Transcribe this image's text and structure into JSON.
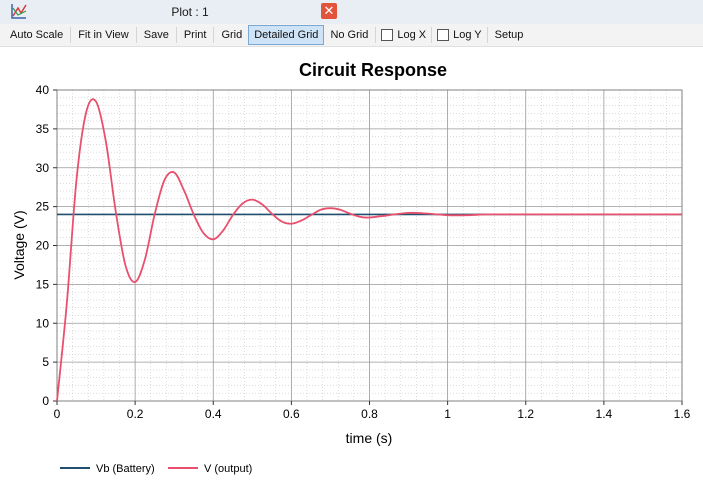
{
  "window": {
    "title": "Plot : 1"
  },
  "toolbar": {
    "auto_scale": "Auto Scale",
    "fit_in_view": "Fit in View",
    "save": "Save",
    "print": "Print",
    "grid": "Grid",
    "detailed_grid": "Detailed Grid",
    "no_grid": "No Grid",
    "log_x": "Log X",
    "log_y": "Log Y",
    "setup": "Setup"
  },
  "colors": {
    "battery": "#1f4e6e",
    "output": "#e8506e",
    "accent": "#cfe3f7"
  },
  "chart_data": {
    "type": "line",
    "title": "Circuit Response",
    "xlabel": "time (s)",
    "ylabel": "Voltage (V)",
    "xlim": [
      0,
      1.6
    ],
    "ylim": [
      0,
      40
    ],
    "xticks": [
      0,
      0.2,
      0.4,
      0.6,
      0.8,
      1,
      1.2,
      1.4,
      1.6
    ],
    "xtick_labels": [
      "0",
      "0.2",
      "0.4",
      "0.6",
      "0.8",
      "1",
      "1.2",
      "1.4",
      "1.6"
    ],
    "yticks": [
      0,
      5,
      10,
      15,
      20,
      25,
      30,
      35,
      40
    ],
    "ytick_labels": [
      "0",
      "5",
      "10",
      "15",
      "20",
      "25",
      "30",
      "35",
      "40"
    ],
    "grid": "detailed",
    "legend_position": "bottom-left",
    "series": [
      {
        "name": "Vb (Battery)",
        "color": "#1f4e6e",
        "x": [
          0,
          1.6
        ],
        "y": [
          24,
          24
        ]
      },
      {
        "name": "V (output)",
        "color": "#e8506e",
        "x": [
          0,
          0.025,
          0.05,
          0.075,
          0.1,
          0.125,
          0.15,
          0.175,
          0.2,
          0.225,
          0.25,
          0.275,
          0.3,
          0.325,
          0.35,
          0.375,
          0.4,
          0.425,
          0.45,
          0.475,
          0.5,
          0.525,
          0.55,
          0.575,
          0.6,
          0.625,
          0.65,
          0.675,
          0.7,
          0.725,
          0.75,
          0.775,
          0.8,
          0.85,
          0.9,
          0.95,
          1.0,
          1.05,
          1.1,
          1.15,
          1.2,
          1.3,
          1.4,
          1.5,
          1.6
        ],
        "y": [
          0,
          12.5,
          28.5,
          37.2,
          38.5,
          33.4,
          24.5,
          17.5,
          15.3,
          18.2,
          24.0,
          28.4,
          29.4,
          27.1,
          24.0,
          21.6,
          20.8,
          21.9,
          23.9,
          25.4,
          25.9,
          25.3,
          24.1,
          23.1,
          22.8,
          23.2,
          23.9,
          24.6,
          24.8,
          24.6,
          24.1,
          23.7,
          23.6,
          23.9,
          24.2,
          24.1,
          23.9,
          23.9,
          24.0,
          24.0,
          24.0,
          24.0,
          24.0,
          24.0,
          24.0
        ]
      }
    ]
  }
}
